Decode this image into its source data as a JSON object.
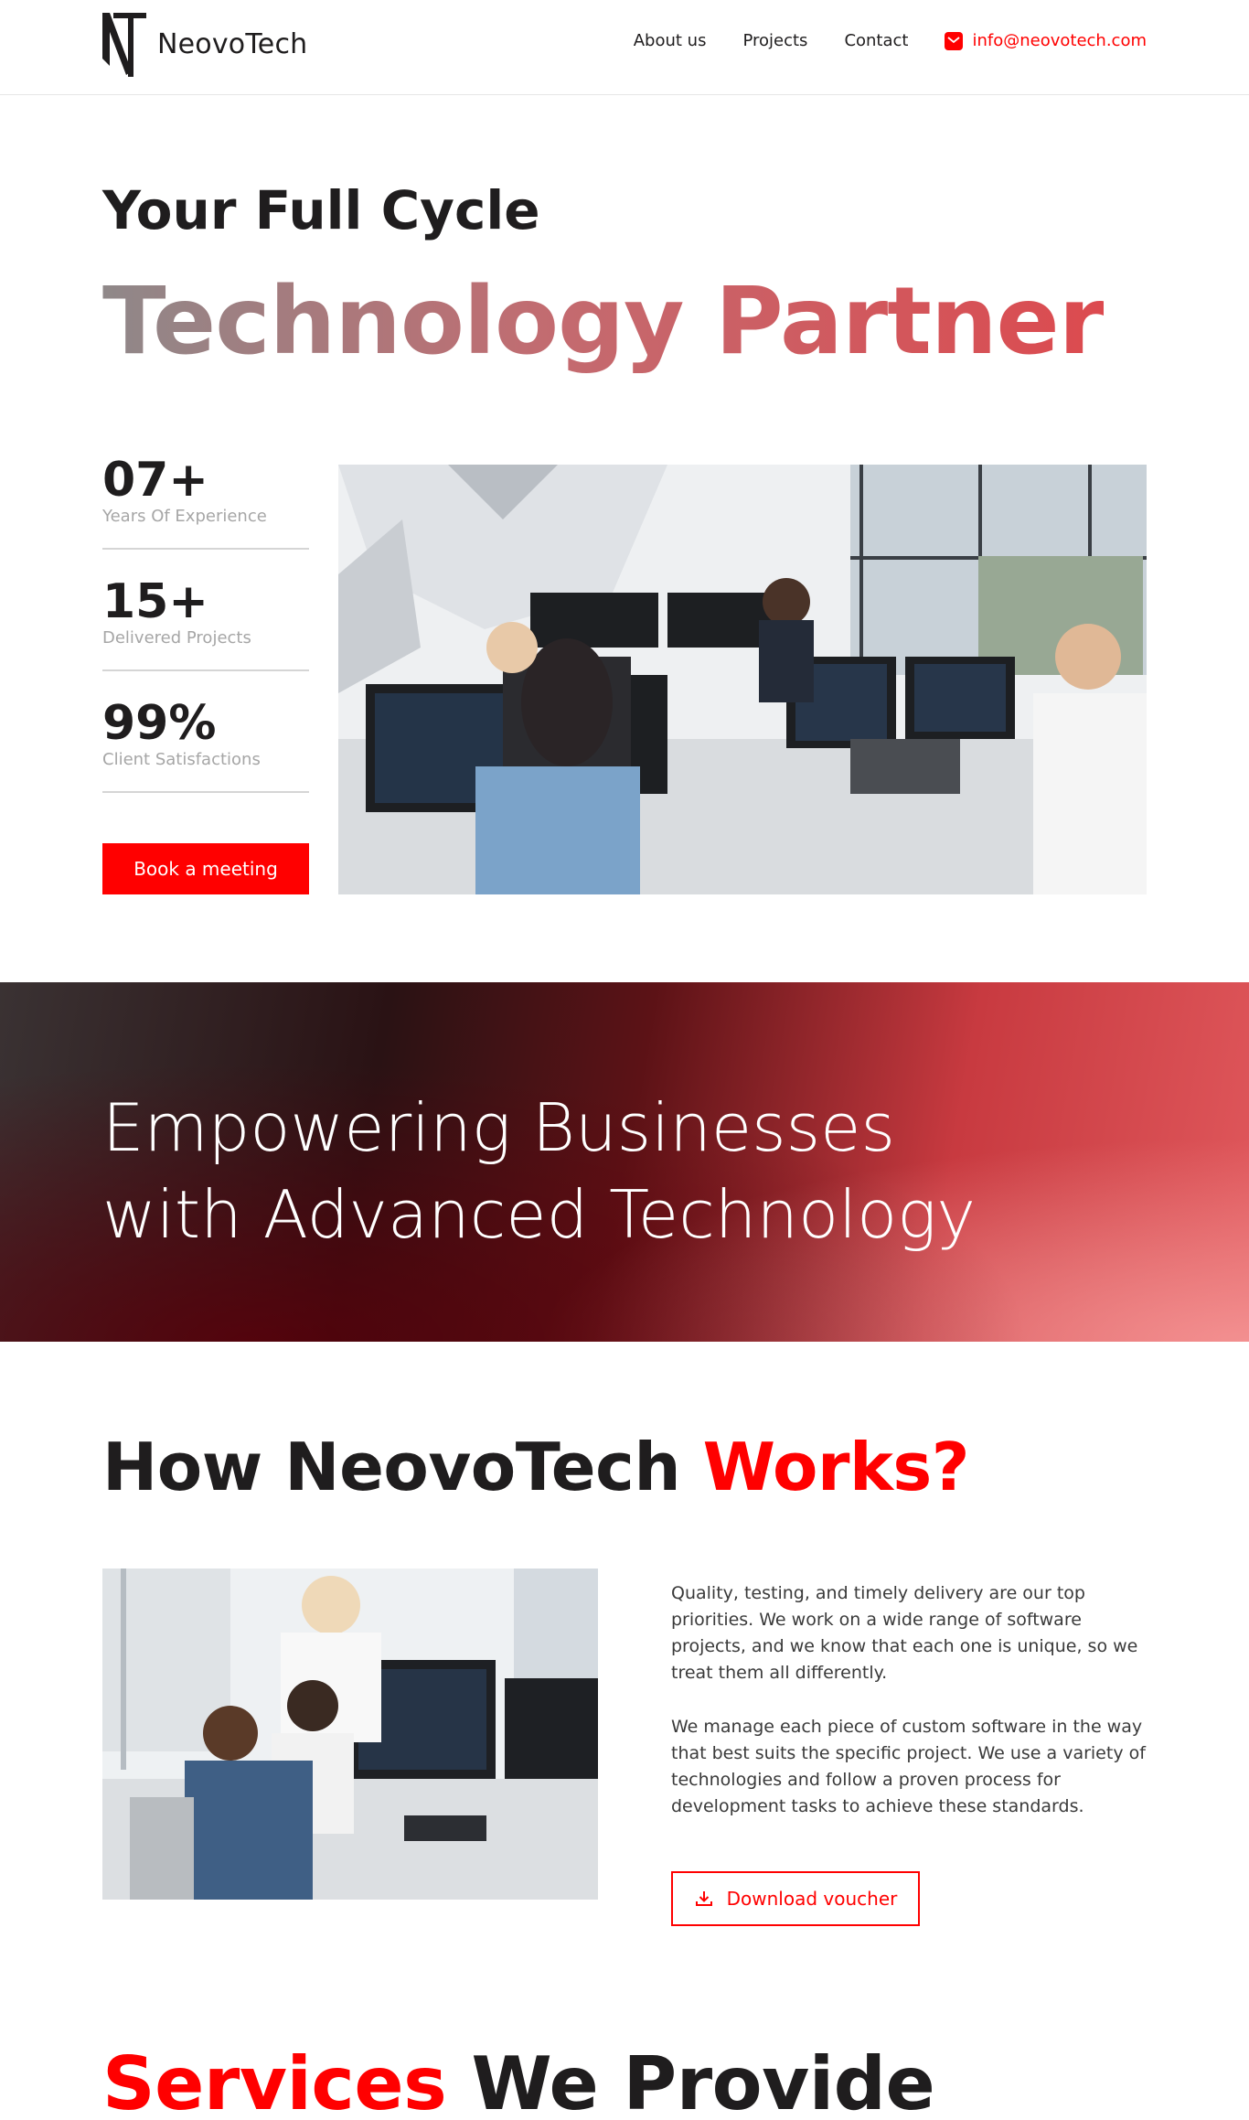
{
  "header": {
    "brand": "NeovoTech",
    "nav": [
      "About us",
      "Projects",
      "Contact"
    ],
    "email": "info@neovotech.com"
  },
  "hero": {
    "line1": "Your Full Cycle",
    "line2": "Technology Partner",
    "stats": [
      {
        "value": "07+",
        "label": "Years Of Experience"
      },
      {
        "value": "15+",
        "label": "Delivered Projects"
      },
      {
        "value": "99%",
        "label": "Client Satisfactions"
      }
    ],
    "cta": "Book a meeting"
  },
  "banner": {
    "line1": "Empowering Businesses",
    "line2": "with Advanced Technology"
  },
  "how": {
    "title_start": "How NeovoTech ",
    "title_accent": "Works?",
    "p1": "Quality, testing, and timely delivery are our top priorities. We work on a wide range of software projects, and we know that each one is unique, so we treat them all differently.",
    "p2": "We manage each piece of custom software in the way that best suits the specific project. We use a variety of technologies and follow a proven process for development tasks to achieve these standards.",
    "button": "Download voucher"
  },
  "services": {
    "title_accent": "Services",
    "title_end": " We Provide"
  },
  "colors": {
    "accent": "#ff0000",
    "text": "#1f1d1e",
    "muted": "#a6a6a6"
  }
}
